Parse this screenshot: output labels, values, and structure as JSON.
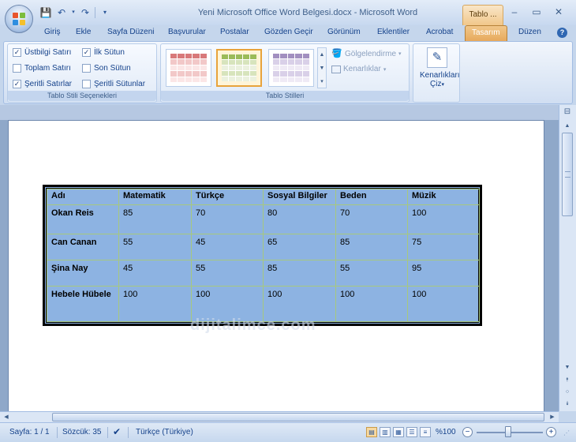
{
  "window": {
    "title": "Yeni Microsoft Office Word Belgesi.docx - Microsoft Word",
    "context_tab_title": "Tablo ...",
    "minimize": "–",
    "maximize": "▭",
    "close": "✕"
  },
  "tabs": [
    {
      "label": "Giriş",
      "active": false
    },
    {
      "label": "Ekle",
      "active": false
    },
    {
      "label": "Sayfa Düzeni",
      "active": false
    },
    {
      "label": "Başvurular",
      "active": false
    },
    {
      "label": "Postalar",
      "active": false
    },
    {
      "label": "Gözden Geçir",
      "active": false
    },
    {
      "label": "Görünüm",
      "active": false
    },
    {
      "label": "Eklentiler",
      "active": false
    },
    {
      "label": "Acrobat",
      "active": false
    },
    {
      "label": "Tasarım",
      "active": true
    },
    {
      "label": "Düzen",
      "active": false
    }
  ],
  "ribbon": {
    "style_options": {
      "group_label": "Tablo Stili Seçenekleri",
      "items": [
        {
          "label": "Üstbilgi Satırı",
          "checked": true
        },
        {
          "label": "Toplam Satırı",
          "checked": false
        },
        {
          "label": "Şeritli Satırlar",
          "checked": true
        },
        {
          "label": "İlk Sütun",
          "checked": true
        },
        {
          "label": "Son Sütun",
          "checked": false
        },
        {
          "label": "Şeritli Sütunlar",
          "checked": false
        }
      ]
    },
    "table_styles": {
      "group_label": "Tablo Stilleri",
      "shading_label": "Gölgelendirme",
      "borders_label": "Kenarlıklar"
    },
    "draw": {
      "label_line1": "Kenarlıkları",
      "label_line2": "Çiz"
    }
  },
  "table": {
    "headers": [
      "Adı",
      "Matematik",
      "Türkçe",
      "Sosyal Bilgiler",
      "Beden",
      "Müzik"
    ],
    "rows": [
      [
        "Okan Reis",
        "85",
        "70",
        "80",
        "70",
        "100"
      ],
      [
        "Can Canan",
        "55",
        "45",
        "65",
        "85",
        "75"
      ],
      [
        "Şina Nay",
        "45",
        "55",
        "85",
        "55",
        "95"
      ],
      [
        "Hebele Hübele",
        "100",
        "100",
        "100",
        "100",
        "100"
      ]
    ]
  },
  "watermark": "dijitalimce.com",
  "statusbar": {
    "page": "Sayfa: 1 / 1",
    "words": "Sözcük: 35",
    "language": "Türkçe (Türkiye)",
    "zoom": "%100"
  },
  "colors": {
    "table_fill": "#8db3e2",
    "table_grid": "#a7c87e",
    "active_tab": "#e6a85a"
  }
}
